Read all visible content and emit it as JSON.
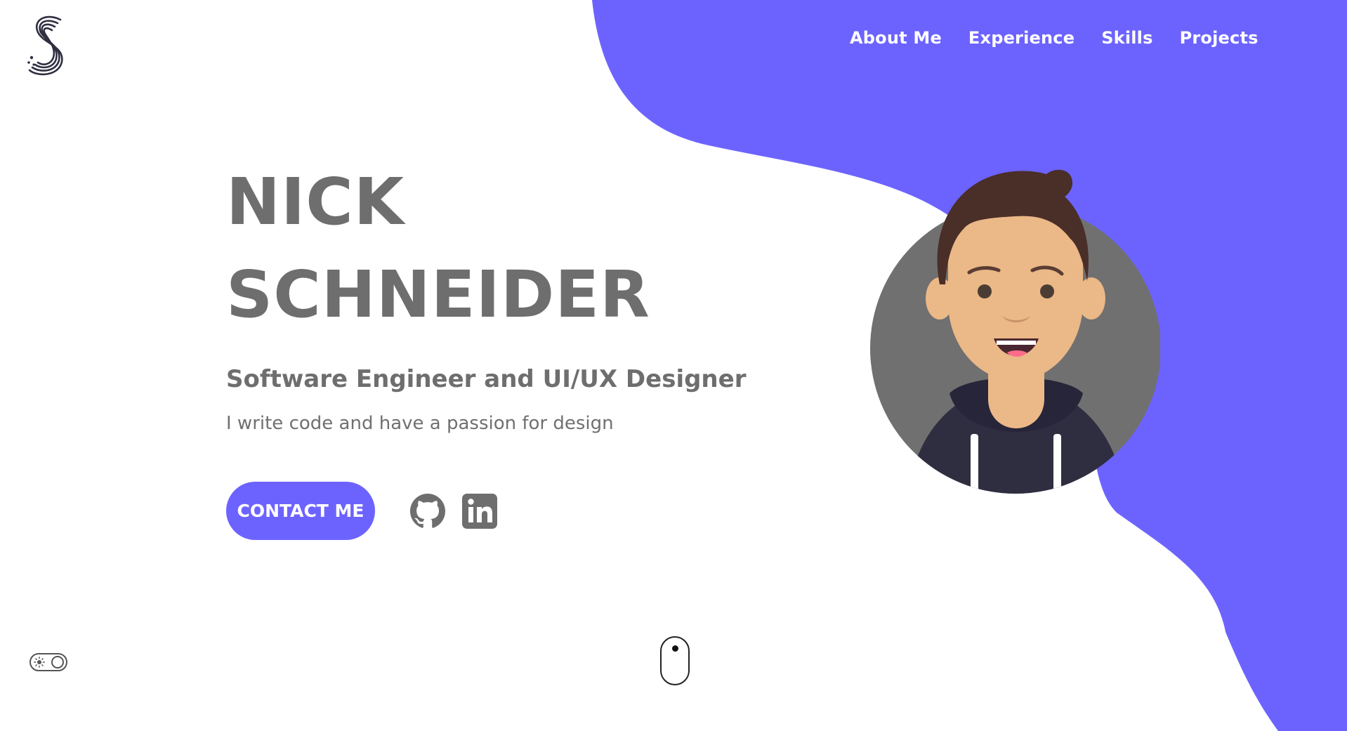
{
  "logo": {
    "icon": "s-logo-icon"
  },
  "nav": {
    "items": [
      {
        "label": "About Me"
      },
      {
        "label": "Experience"
      },
      {
        "label": "Skills"
      },
      {
        "label": "Projects"
      }
    ]
  },
  "hero": {
    "first_name": "NICK",
    "last_name": "SCHNEIDER",
    "subtitle": "Software Engineer and UI/UX Designer",
    "tagline": "I write code and have a passion for design",
    "contact_label": "CONTACT ME"
  },
  "social": [
    {
      "icon": "github-icon"
    },
    {
      "icon": "linkedin-icon"
    }
  ],
  "theme_toggle": {
    "icon": "sun-icon",
    "state": "light"
  },
  "colors": {
    "accent": "#6c63ff",
    "text": "#6e6e6e",
    "background": "#ffffff",
    "avatar_bg": "#707070",
    "hair": "#4a2e28",
    "skin": "#ebb887",
    "hoodie": "#2f2e41"
  }
}
